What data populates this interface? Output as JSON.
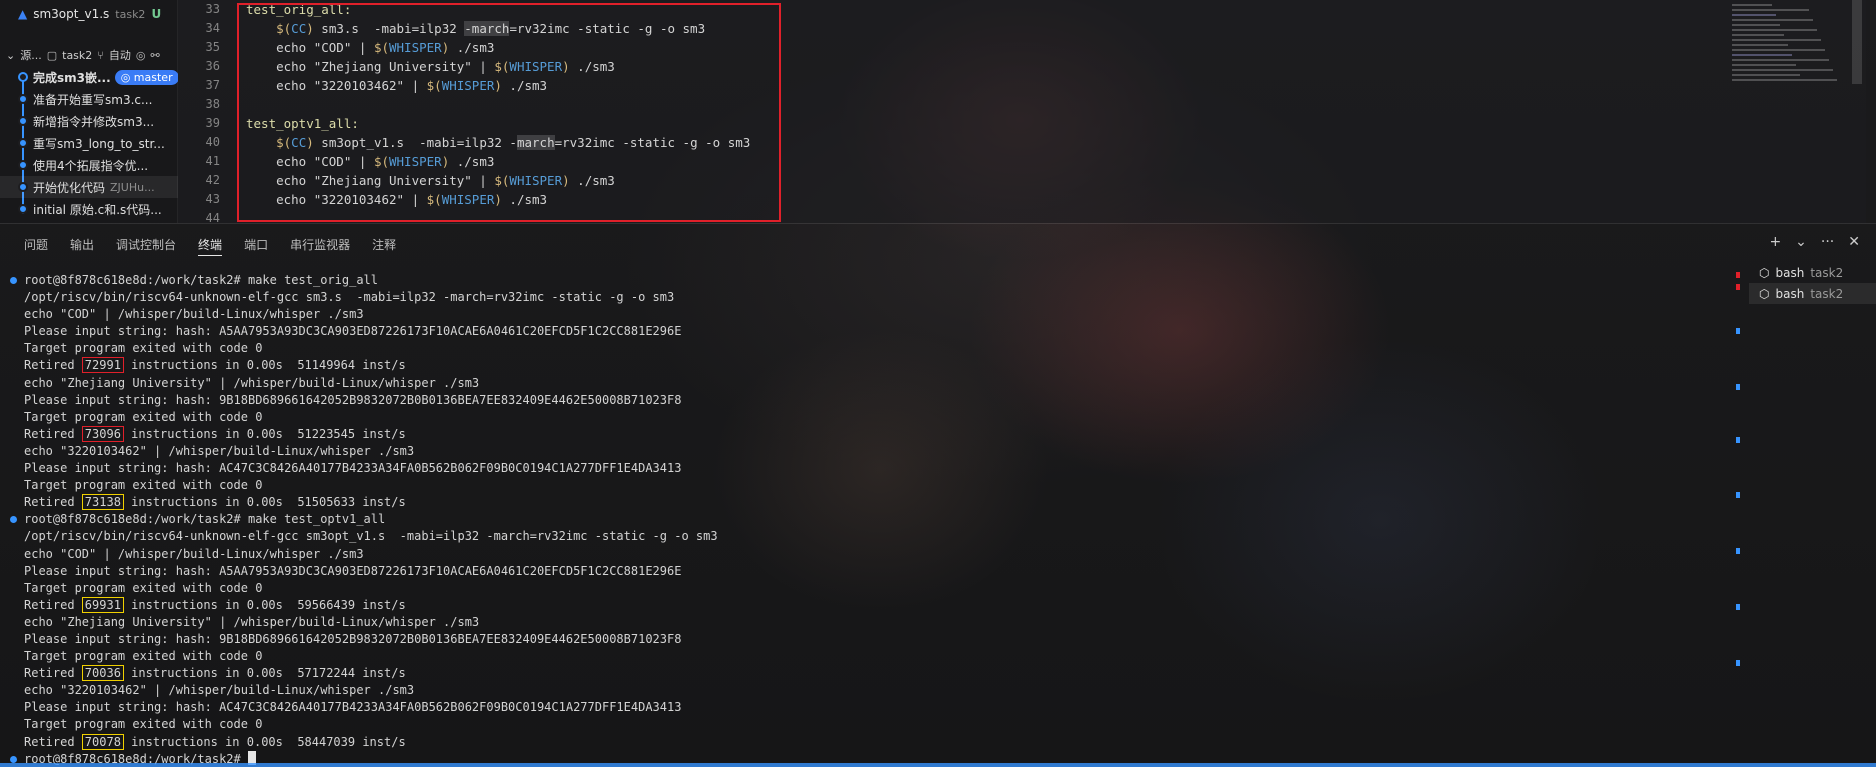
{
  "sidebar": {
    "open_file": {
      "name": "sm3opt_v1.s",
      "dir": "task2",
      "status": "U"
    },
    "scm": {
      "title": "源...",
      "repo": "task2",
      "branch_mode": "自动"
    },
    "commits": [
      {
        "message": "完成sm3嵌...",
        "badge": "master",
        "author": ""
      },
      {
        "message": "准备开始重写sm3.c...",
        "badge": "",
        "author": ""
      },
      {
        "message": "新增指令并修改sm3...",
        "badge": "",
        "author": ""
      },
      {
        "message": "重写sm3_long_to_str...",
        "badge": "",
        "author": ""
      },
      {
        "message": "使用4个拓展指令优...",
        "badge": "",
        "author": ""
      },
      {
        "message": "开始优化代码",
        "badge": "",
        "author": "ZJUHu..."
      },
      {
        "message": "initial 原始.c和.s代码...",
        "badge": "",
        "author": ""
      }
    ]
  },
  "editor": {
    "line_numbers": [
      "33",
      "34",
      "35",
      "36",
      "37",
      "38",
      "39",
      "40",
      "41",
      "42",
      "43",
      "44"
    ],
    "lines": [
      {
        "t": "label",
        "text": "test_orig_all:"
      },
      {
        "t": "cmd",
        "pre": "    ",
        "var": "CC",
        "rest1": " sm3.s  -mabi=ilp32 ",
        "hl": "-march",
        "rest2": "=rv32imc -static -g -o sm3"
      },
      {
        "t": "echo",
        "text": "    echo \"COD\" | ",
        "var": "WHISPER",
        "rest": " ./sm3"
      },
      {
        "t": "echo",
        "text": "    echo \"Zhejiang University\" | ",
        "var": "WHISPER",
        "rest": " ./sm3"
      },
      {
        "t": "echo",
        "text": "    echo \"3220103462\" | ",
        "var": "WHISPER",
        "rest": " ./sm3"
      },
      {
        "t": "blank",
        "text": ""
      },
      {
        "t": "label",
        "text": "test_optv1_all:"
      },
      {
        "t": "cmd",
        "pre": "    ",
        "var": "CC",
        "rest1": " sm3opt_v1.s  -mabi=ilp32 -",
        "hl": "march",
        "rest2": "=rv32imc -static -g -o sm3"
      },
      {
        "t": "echo",
        "text": "    echo \"COD\" | ",
        "var": "WHISPER",
        "rest": " ./sm3"
      },
      {
        "t": "echo",
        "text": "    echo \"Zhejiang University\" | ",
        "var": "WHISPER",
        "rest": " ./sm3"
      },
      {
        "t": "echo",
        "text": "    echo \"3220103462\" | ",
        "var": "WHISPER",
        "rest": " ./sm3"
      },
      {
        "t": "blank",
        "text": ""
      }
    ]
  },
  "panel": {
    "tabs": [
      "问题",
      "输出",
      "调试控制台",
      "终端",
      "端口",
      "串行监视器",
      "注释"
    ],
    "active_tab": "终端",
    "terminals": [
      {
        "name": "bash",
        "dir": "task2"
      },
      {
        "name": "bash",
        "dir": "task2"
      }
    ]
  },
  "terminal_lines": [
    {
      "type": "prompt",
      "text": "root@8f878c618e8d:/work/task2# make test_orig_all"
    },
    {
      "type": "out",
      "text": "/opt/riscv/bin/riscv64-unknown-elf-gcc sm3.s  -mabi=ilp32 -march=rv32imc -static -g -o sm3"
    },
    {
      "type": "out",
      "text": "echo \"COD\" | /whisper/build-Linux/whisper ./sm3"
    },
    {
      "type": "out",
      "text": "Please input string: hash: A5AA7953A93DC3CA903ED87226173F10ACAE6A0461C20EFCD5F1C2CC881E296E"
    },
    {
      "type": "out",
      "text": "Target program exited with code 0"
    },
    {
      "type": "retired",
      "pre": "Retired ",
      "num": "72991",
      "box": "red",
      "post": " instructions in 0.00s  51149964 inst/s"
    },
    {
      "type": "out",
      "text": "echo \"Zhejiang University\" | /whisper/build-Linux/whisper ./sm3"
    },
    {
      "type": "out",
      "text": "Please input string: hash: 9B18BD689661642052B9832072B0B0136BEA7EE832409E4462E50008B71023F8"
    },
    {
      "type": "out",
      "text": "Target program exited with code 0"
    },
    {
      "type": "retired",
      "pre": "Retired ",
      "num": "73096",
      "box": "red",
      "post": " instructions in 0.00s  51223545 inst/s"
    },
    {
      "type": "out",
      "text": "echo \"3220103462\" | /whisper/build-Linux/whisper ./sm3"
    },
    {
      "type": "out",
      "text": "Please input string: hash: AC47C3C8426A40177B4233A34FA0B562B062F09B0C0194C1A277DFF1E4DA3413"
    },
    {
      "type": "out",
      "text": "Target program exited with code 0"
    },
    {
      "type": "retired",
      "pre": "Retired ",
      "num": "73138",
      "box": "yellow",
      "post": " instructions in 0.00s  51505633 inst/s"
    },
    {
      "type": "prompt",
      "text": "root@8f878c618e8d:/work/task2# make test_optv1_all"
    },
    {
      "type": "out",
      "text": "/opt/riscv/bin/riscv64-unknown-elf-gcc sm3opt_v1.s  -mabi=ilp32 -march=rv32imc -static -g -o sm3"
    },
    {
      "type": "out",
      "text": "echo \"COD\" | /whisper/build-Linux/whisper ./sm3"
    },
    {
      "type": "out",
      "text": "Please input string: hash: A5AA7953A93DC3CA903ED87226173F10ACAE6A0461C20EFCD5F1C2CC881E296E"
    },
    {
      "type": "out",
      "text": "Target program exited with code 0"
    },
    {
      "type": "retired",
      "pre": "Retired ",
      "num": "69931",
      "box": "yellow",
      "post": " instructions in 0.00s  59566439 inst/s"
    },
    {
      "type": "out",
      "text": "echo \"Zhejiang University\" | /whisper/build-Linux/whisper ./sm3"
    },
    {
      "type": "out",
      "text": "Please input string: hash: 9B18BD689661642052B9832072B0B0136BEA7EE832409E4462E50008B71023F8"
    },
    {
      "type": "out",
      "text": "Target program exited with code 0"
    },
    {
      "type": "retired",
      "pre": "Retired ",
      "num": "70036",
      "box": "yellow",
      "post": " instructions in 0.00s  57172244 inst/s"
    },
    {
      "type": "out",
      "text": "echo \"3220103462\" | /whisper/build-Linux/whisper ./sm3"
    },
    {
      "type": "out",
      "text": "Please input string: hash: AC47C3C8426A40177B4233A34FA0B562B062F09B0C0194C1A277DFF1E4DA3413"
    },
    {
      "type": "out",
      "text": "Target program exited with code 0"
    },
    {
      "type": "retired",
      "pre": "Retired ",
      "num": "70078",
      "box": "yellow",
      "post": " instructions in 0.00s  58447039 inst/s"
    },
    {
      "type": "cursor",
      "text": "root@8f878c618e8d:/work/task2# "
    }
  ],
  "colors": {
    "accent": "#3794ff",
    "highlight_red": "#e0202a",
    "highlight_yellow": "#f0d000"
  },
  "icons": [
    "file-asm-icon",
    "branch-icon",
    "sync-icon",
    "filter-icon",
    "add-terminal-icon",
    "chevron-down-icon",
    "more-icon",
    "close-icon",
    "terminal-icon"
  ]
}
